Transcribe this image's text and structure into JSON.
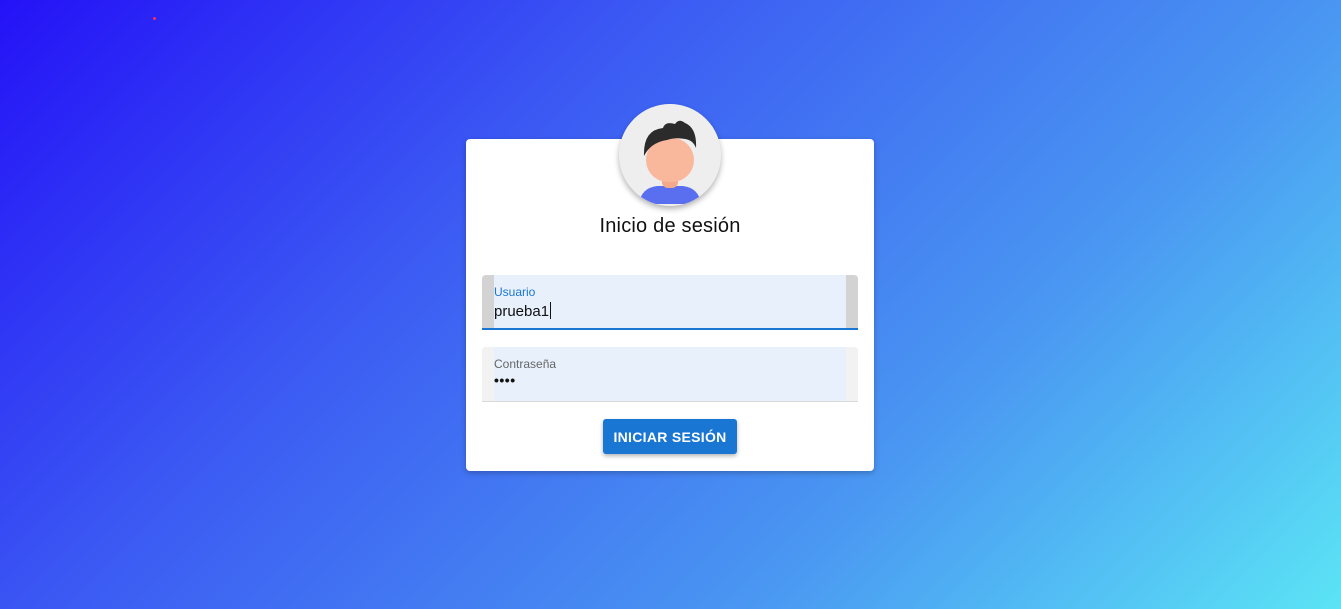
{
  "login": {
    "title": "Inicio de sesión",
    "avatar_icon": "user-avatar-icon",
    "username": {
      "label": "Usuario",
      "value": "prueba1"
    },
    "password": {
      "label": "Contraseña",
      "value": "••••"
    },
    "submit_label": "INICIAR SESIÓN"
  },
  "colors": {
    "accent": "#1976d2",
    "field_background": "#e8f0fc",
    "gradient_start": "#2412f7",
    "gradient_end": "#5be4f5"
  }
}
